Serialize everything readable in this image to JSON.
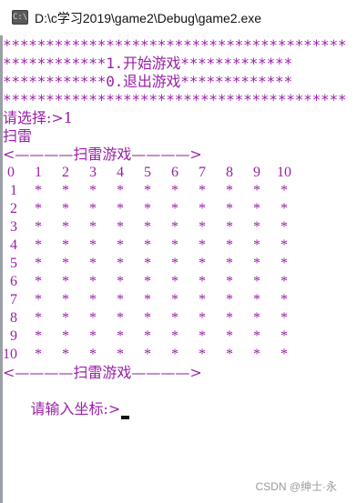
{
  "window": {
    "title": "D:\\c学习2019\\game2\\Debug\\game2.exe",
    "icon": "console-app-icon"
  },
  "colors": {
    "text": "#9a1fa8",
    "background": "#ffffff"
  },
  "menu": {
    "border_line": "****************************************",
    "option_1": "************1.开始游戏*************",
    "option_0": "************0.退出游戏*************"
  },
  "prompt": {
    "choose": "请选择:>1",
    "mode": "扫雷",
    "header": "<————扫雷游戏————>",
    "footer": "<————扫雷游戏————>",
    "input": "请输入坐标:>"
  },
  "board": {
    "column_labels": [
      "0",
      "1",
      "2",
      "3",
      "4",
      "5",
      "6",
      "7",
      "8",
      "9",
      "10"
    ],
    "row_labels": [
      "1",
      "2",
      "3",
      "4",
      "5",
      "6",
      "7",
      "8",
      "9",
      "10"
    ],
    "hidden_cell": "*"
  },
  "watermark": "CSDN @绅士·永"
}
